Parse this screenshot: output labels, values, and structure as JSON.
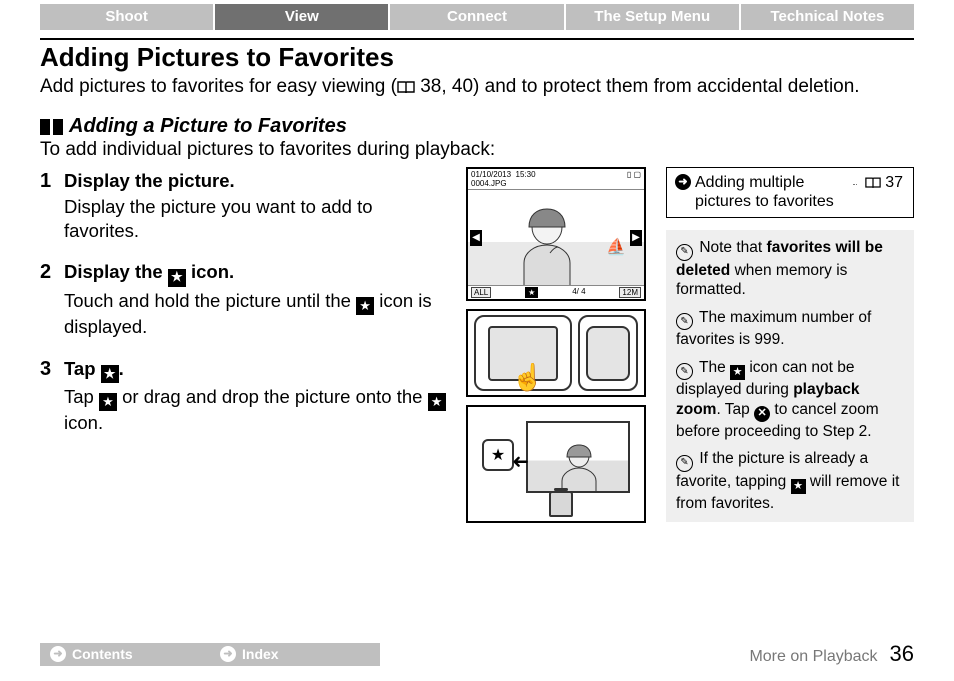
{
  "tabs": {
    "shoot": "Shoot",
    "view": "View",
    "connect": "Connect",
    "setup": "The Setup Menu",
    "tech": "Technical Notes",
    "active": "view"
  },
  "h1": "Adding Pictures to Favorites",
  "intro_pre": "Add pictures to favorites for easy viewing (",
  "intro_refs": " 38, 40",
  "intro_post": ") and to protect them from accidental deletion.",
  "sub_heading": "Adding a Picture to Favorites",
  "sub_intro": "To add individual pictures to favorites during playback:",
  "steps": {
    "s1_num": "1",
    "s1_title": "Display the picture.",
    "s1_body": "Display the picture you want to add to favorites.",
    "s2_num": "2",
    "s2_title_pre": "Display the ",
    "s2_title_post": " icon.",
    "s2_body_pre": "Touch and hold the picture until the ",
    "s2_body_post": " icon is displayed.",
    "s3_num": "3",
    "s3_title_pre": "Tap ",
    "s3_title_post": ".",
    "s3_body_pre": "Tap ",
    "s3_body_mid": " or drag and drop the picture onto the ",
    "s3_body_post": " icon."
  },
  "lcd": {
    "date": "01/10/2013",
    "time": "15:30",
    "file": "0004.JPG",
    "all": "ALL",
    "count": "4/   4",
    "size": "12M"
  },
  "xref": {
    "text": "Adding multiple pictures to favorites",
    "page": " 37"
  },
  "notes": {
    "n1_pre": "Note that ",
    "n1_bold": "favorites will be deleted",
    "n1_post": " when memory is formatted.",
    "n2": "The maximum number of favorites is 999.",
    "n3_pre": "The ",
    "n3_mid": " icon can not be displayed during ",
    "n3_bold": "playback zoom",
    "n3_post1": ". Tap ",
    "n3_post2": " to cancel zoom before proceeding to Step 2.",
    "n4_pre": "If the picture is already a favorite, tapping ",
    "n4_post": " will remove it from favorites."
  },
  "footer": {
    "contents": "Contents",
    "index": "Index",
    "section": "More on Playback",
    "page": "36"
  },
  "icons": {
    "star": "★",
    "arrow_in_circle": "➜",
    "cancel": "✕",
    "pencil": "✎",
    "left": "◀",
    "right": "▶",
    "boat": "⛵"
  }
}
